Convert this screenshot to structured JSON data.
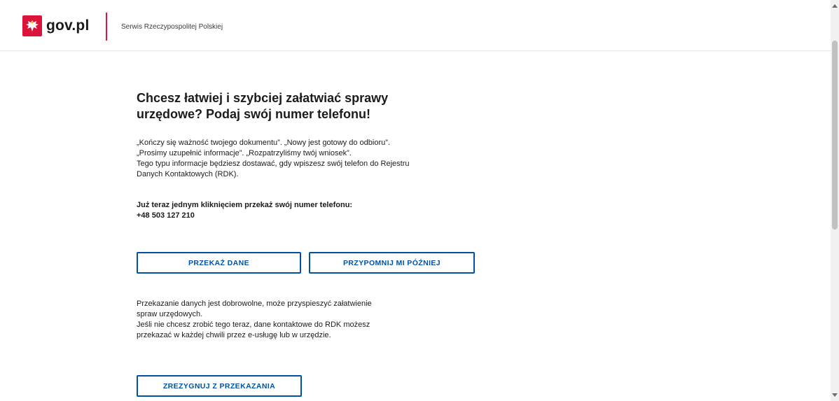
{
  "header": {
    "logo_text": "gov.pl",
    "subtitle": "Serwis Rzeczypospolitej Polskiej"
  },
  "main": {
    "heading_line1": "Chcesz łatwiej i szybciej załatwiać sprawy",
    "heading_line2": "urzędowe? Podaj swój numer telefonu!",
    "intro_lines": [
      "„Kończy się ważność twojego dokumentu”. „Nowy jest gotowy do odbioru”.",
      "„Prosimy uzupełnić informacje”. „Rozpatrzyliśmy twój wniosek”.",
      "Tego typu informacje będziesz dostawać, gdy wpiszesz swój telefon do Rejestru",
      "Danych Kontaktowych (RDK)."
    ],
    "transfer_prompt": "Już teraz jednym kliknięciem przekaż swój numer telefonu:",
    "phone_number": "+48 503 127 210",
    "submit_button": "PRZEKAŻ DANE",
    "remind_button": "PRZYPOMNIJ MI PÓŹNIEJ",
    "note_lines": [
      "Przekazanie danych jest dobrowolne, może przyspieszyć załatwienie",
      "spraw urzędowych.",
      "Jeśli nie chcesz zrobić tego teraz, dane kontaktowe do RDK możesz",
      "przekazać w każdej chwili przez e-usługę lub w urzędzie."
    ],
    "resign_button": "ZREZYGNUJ Z PRZEKAZANIA"
  },
  "colors": {
    "brand_red": "#dc143c",
    "button_blue": "#0052a5"
  }
}
